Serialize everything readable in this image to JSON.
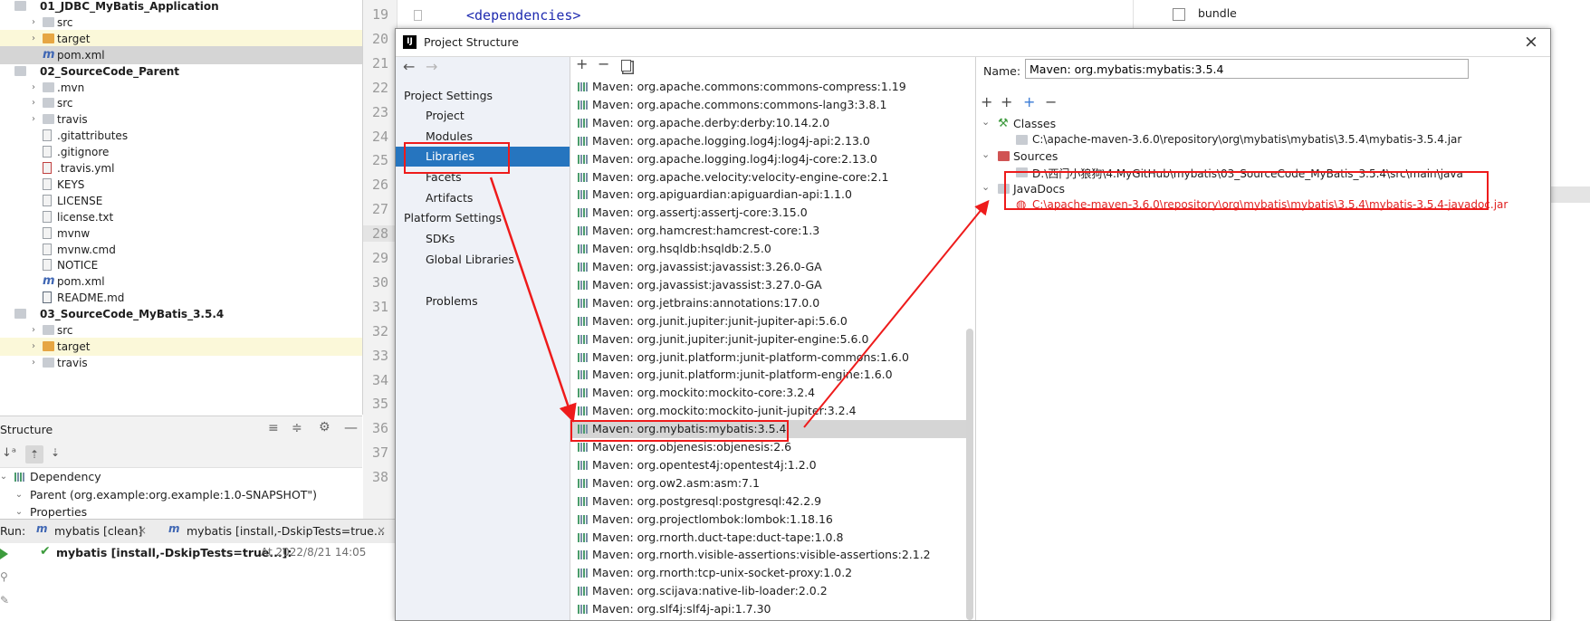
{
  "project_tree": {
    "items": [
      {
        "label": "01_JDBC_MyBatis_Application",
        "indent": 0,
        "arrow": "⌄",
        "icon": "folder",
        "bold": true,
        "hl": ""
      },
      {
        "label": "src",
        "indent": 1,
        "arrow": "›",
        "icon": "folder",
        "bold": false,
        "hl": ""
      },
      {
        "label": "target",
        "indent": 1,
        "arrow": "›",
        "icon": "folder-orange",
        "bold": false,
        "hl": "y"
      },
      {
        "label": "pom.xml",
        "indent": 1,
        "arrow": "",
        "icon": "maven",
        "bold": false,
        "hl": "g"
      },
      {
        "label": "02_SourceCode_Parent",
        "indent": 0,
        "arrow": "⌄",
        "icon": "folder",
        "bold": true,
        "hl": ""
      },
      {
        "label": ".mvn",
        "indent": 1,
        "arrow": "›",
        "icon": "folder",
        "bold": false,
        "hl": ""
      },
      {
        "label": "src",
        "indent": 1,
        "arrow": "›",
        "icon": "folder",
        "bold": false,
        "hl": ""
      },
      {
        "label": "travis",
        "indent": 1,
        "arrow": "›",
        "icon": "folder",
        "bold": false,
        "hl": ""
      },
      {
        "label": ".gitattributes",
        "indent": 1,
        "arrow": "",
        "icon": "file",
        "bold": false,
        "hl": ""
      },
      {
        "label": ".gitignore",
        "indent": 1,
        "arrow": "",
        "icon": "file",
        "bold": false,
        "hl": ""
      },
      {
        "label": ".travis.yml",
        "indent": 1,
        "arrow": "",
        "icon": "yml",
        "bold": false,
        "hl": ""
      },
      {
        "label": "KEYS",
        "indent": 1,
        "arrow": "",
        "icon": "file",
        "bold": false,
        "hl": ""
      },
      {
        "label": "LICENSE",
        "indent": 1,
        "arrow": "",
        "icon": "file",
        "bold": false,
        "hl": ""
      },
      {
        "label": "license.txt",
        "indent": 1,
        "arrow": "",
        "icon": "file",
        "bold": false,
        "hl": ""
      },
      {
        "label": "mvnw",
        "indent": 1,
        "arrow": "",
        "icon": "file",
        "bold": false,
        "hl": ""
      },
      {
        "label": "mvnw.cmd",
        "indent": 1,
        "arrow": "",
        "icon": "file",
        "bold": false,
        "hl": ""
      },
      {
        "label": "NOTICE",
        "indent": 1,
        "arrow": "",
        "icon": "file",
        "bold": false,
        "hl": ""
      },
      {
        "label": "pom.xml",
        "indent": 1,
        "arrow": "",
        "icon": "maven",
        "bold": false,
        "hl": ""
      },
      {
        "label": "README.md",
        "indent": 1,
        "arrow": "",
        "icon": "md",
        "bold": false,
        "hl": ""
      },
      {
        "label": "03_SourceCode_MyBatis_3.5.4",
        "indent": 0,
        "arrow": "⌄",
        "icon": "folder",
        "bold": true,
        "hl": ""
      },
      {
        "label": "src",
        "indent": 1,
        "arrow": "›",
        "icon": "folder",
        "bold": false,
        "hl": ""
      },
      {
        "label": "target",
        "indent": 1,
        "arrow": "›",
        "icon": "folder-orange",
        "bold": false,
        "hl": "y"
      },
      {
        "label": "travis",
        "indent": 1,
        "arrow": "›",
        "icon": "folder",
        "bold": false,
        "hl": ""
      }
    ]
  },
  "gutter": {
    "lines": [
      "19",
      "20",
      "21",
      "22",
      "23",
      "24",
      "25",
      "26",
      "27",
      "28",
      "29",
      "30",
      "31",
      "32",
      "33",
      "34",
      "35",
      "36",
      "37",
      "38"
    ]
  },
  "editor": {
    "code": "<dependencies>",
    "right_checkbox_label": "bundle"
  },
  "structure": {
    "title": "Structure",
    "items": [
      {
        "label": "Dependency",
        "arrow": "⌄",
        "indent": 0
      },
      {
        "label": "Parent (org.example:org.example:1.0-SNAPSHOT\")",
        "arrow": "⌄",
        "indent": 1
      },
      {
        "label": "Properties",
        "arrow": "⌄",
        "indent": 1
      }
    ]
  },
  "run": {
    "label": "Run:",
    "tabs": [
      "mybatis [clean]",
      "mybatis [install,-DskipTests=true..."
    ],
    "entry": "mybatis [install,-DskipTests=true...]:",
    "timestamp": "At 2022/8/21 14:05"
  },
  "dialog": {
    "title": "Project Structure",
    "nav": {
      "project_settings": "Project Settings",
      "items_a": [
        "Project",
        "Modules",
        "Libraries",
        "Facets",
        "Artifacts"
      ],
      "platform_settings": "Platform Settings",
      "items_b": [
        "SDKs",
        "Global Libraries"
      ],
      "problems": "Problems",
      "selected": "Libraries"
    },
    "libraries": [
      "Maven: org.apache.commons:commons-compress:1.19",
      "Maven: org.apache.commons:commons-lang3:3.8.1",
      "Maven: org.apache.derby:derby:10.14.2.0",
      "Maven: org.apache.logging.log4j:log4j-api:2.13.0",
      "Maven: org.apache.logging.log4j:log4j-core:2.13.0",
      "Maven: org.apache.velocity:velocity-engine-core:2.1",
      "Maven: org.apiguardian:apiguardian-api:1.1.0",
      "Maven: org.assertj:assertj-core:3.15.0",
      "Maven: org.hamcrest:hamcrest-core:1.3",
      "Maven: org.hsqldb:hsqldb:2.5.0",
      "Maven: org.javassist:javassist:3.26.0-GA",
      "Maven: org.javassist:javassist:3.27.0-GA",
      "Maven: org.jetbrains:annotations:17.0.0",
      "Maven: org.junit.jupiter:junit-jupiter-api:5.6.0",
      "Maven: org.junit.jupiter:junit-jupiter-engine:5.6.0",
      "Maven: org.junit.platform:junit-platform-commons:1.6.0",
      "Maven: org.junit.platform:junit-platform-engine:1.6.0",
      "Maven: org.mockito:mockito-core:3.2.4",
      "Maven: org.mockito:mockito-junit-jupiter:3.2.4",
      "Maven: org.mybatis:mybatis:3.5.4",
      "Maven: org.objenesis:objenesis:2.6",
      "Maven: org.opentest4j:opentest4j:1.2.0",
      "Maven: org.ow2.asm:asm:7.1",
      "Maven: org.postgresql:postgresql:42.2.9",
      "Maven: org.projectlombok:lombok:1.18.16",
      "Maven: org.rnorth.duct-tape:duct-tape:1.0.8",
      "Maven: org.rnorth.visible-assertions:visible-assertions:2.1.2",
      "Maven: org.rnorth:tcp-unix-socket-proxy:1.0.2",
      "Maven: org.scijava:native-lib-loader:2.0.2",
      "Maven: org.slf4j:slf4j-api:1.7.30"
    ],
    "selected_library_index": 19,
    "detail": {
      "name_label": "Name:",
      "name_value": "Maven: org.mybatis:mybatis:3.5.4",
      "classes_label": "Classes",
      "classes_path": "C:\\apache-maven-3.6.0\\repository\\org\\mybatis\\mybatis\\3.5.4\\mybatis-3.5.4.jar",
      "sources_label": "Sources",
      "sources_path": "D:\\西门小狼狗\\4.MyGitHub\\mybatis\\03_SourceCode_MyBatis_3.5.4\\src\\main\\java",
      "javadocs_label": "JavaDocs",
      "javadocs_path": "C:\\apache-maven-3.6.0\\repository\\org\\mybatis\\mybatis\\3.5.4\\mybatis-3.5.4-javadoc.jar"
    }
  },
  "colors": {
    "selection_blue": "#2675bf",
    "annotation_red": "#ee1b1b",
    "javadoc_red": "#e02020",
    "tag_blue": "#1f2bb0"
  }
}
